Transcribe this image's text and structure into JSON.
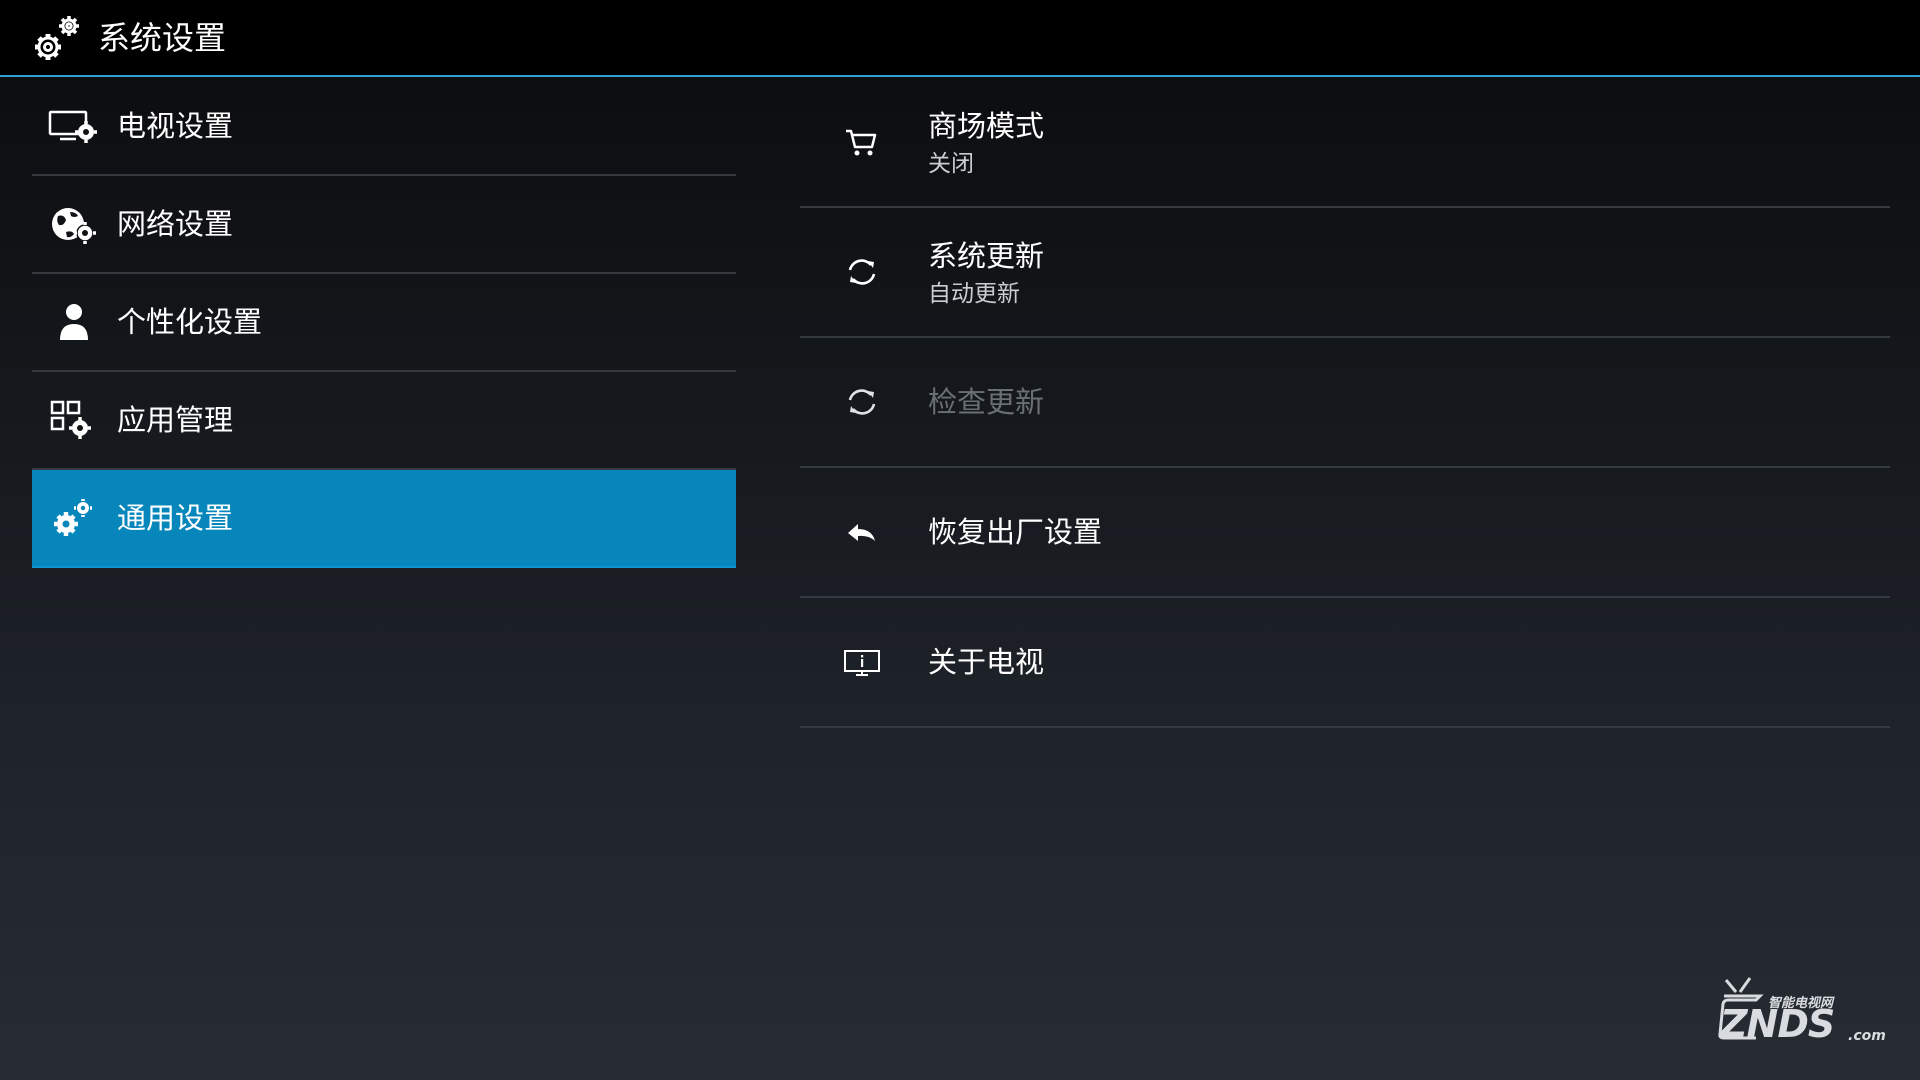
{
  "header": {
    "title": "系统设置",
    "icon": "gears-icon"
  },
  "sidebar": {
    "items": [
      {
        "label": "电视设置",
        "icon": "tv-settings-icon"
      },
      {
        "label": "网络设置",
        "icon": "globe-settings-icon"
      },
      {
        "label": "个性化设置",
        "icon": "person-icon"
      },
      {
        "label": "应用管理",
        "icon": "apps-settings-icon"
      },
      {
        "label": "通用设置",
        "icon": "gears-icon",
        "selected": true
      }
    ]
  },
  "content": {
    "rows": [
      {
        "title": "商场模式",
        "subtitle": "关闭",
        "icon": "cart-icon"
      },
      {
        "title": "系统更新",
        "subtitle": "自动更新",
        "icon": "refresh-icon"
      },
      {
        "title": "检查更新",
        "icon": "refresh-icon",
        "disabled": true
      },
      {
        "title": "恢复出厂设置",
        "icon": "reply-arrow-icon"
      },
      {
        "title": "关于电视",
        "icon": "tv-info-icon"
      }
    ]
  },
  "watermark": {
    "brand": "ZNDS",
    "tagline": "智能电视网",
    "suffix": ".com"
  },
  "colors": {
    "accent": "#2e9fd8",
    "selected_bg": "#0786bb",
    "divider": "#343940",
    "disabled_text": "#6a6f76"
  }
}
